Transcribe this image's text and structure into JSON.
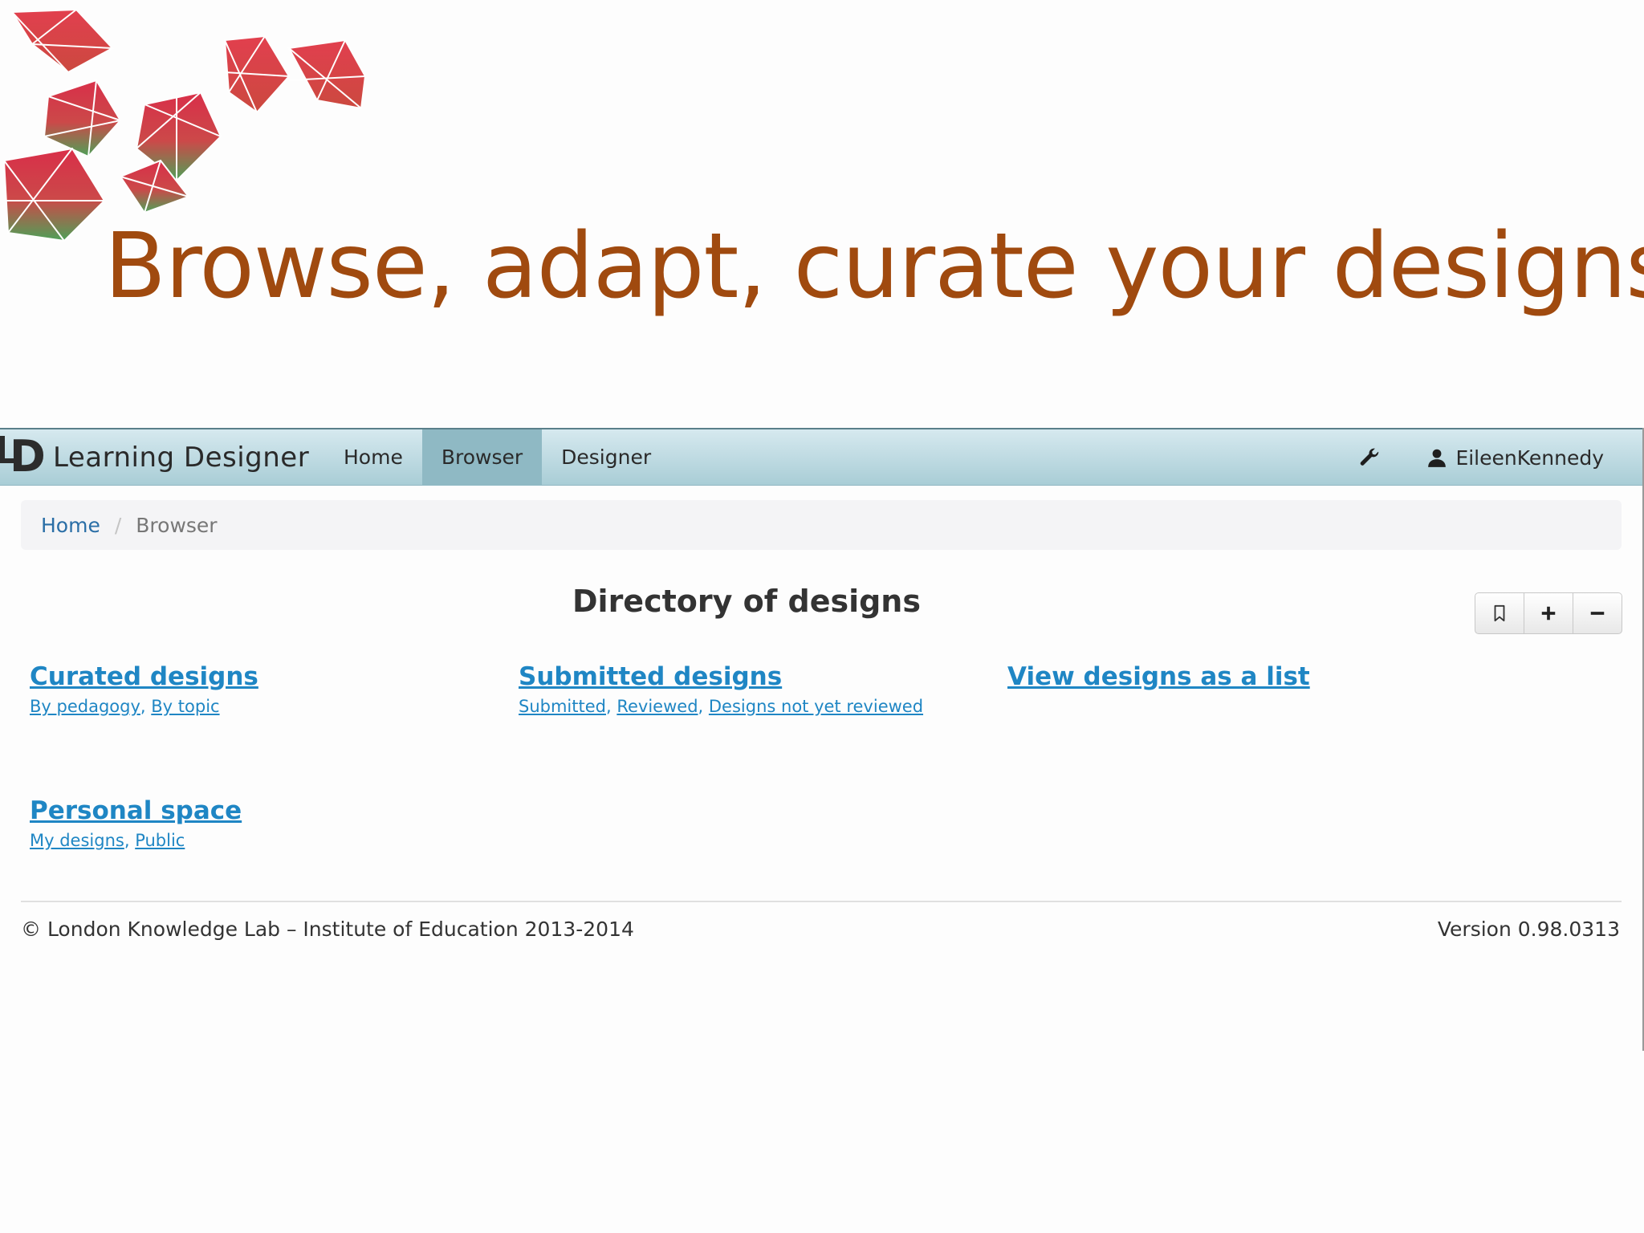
{
  "slide": {
    "title": "Browse, adapt, curate your designs"
  },
  "navbar": {
    "brand_name": "Learning Designer",
    "items": [
      {
        "label": "Home",
        "active": false
      },
      {
        "label": "Browser",
        "active": true
      },
      {
        "label": "Designer",
        "active": false
      }
    ],
    "settings_icon": "wrench-icon",
    "user_icon": "user-icon",
    "username": "EileenKennedy"
  },
  "breadcrumb": {
    "home": "Home",
    "separator": "/",
    "current": "Browser"
  },
  "main": {
    "title": "Directory of designs",
    "toolbar": {
      "icons": [
        "bookmark-icon",
        "plus-icon",
        "minus-icon"
      ]
    },
    "sections": [
      {
        "title": "Curated designs",
        "links": [
          "By pedagogy",
          "By topic"
        ]
      },
      {
        "title": "Submitted designs",
        "links": [
          "Submitted",
          "Reviewed",
          "Designs not yet reviewed"
        ]
      },
      {
        "title": "View designs as a list",
        "links": []
      },
      {
        "title": "Personal space",
        "links": [
          "My designs",
          "Public"
        ]
      }
    ]
  },
  "footer": {
    "copyright": "© London Knowledge Lab – Institute of Education 2013-2014",
    "version": "Version 0.98.0313"
  },
  "colors": {
    "title": "#a04a0f",
    "link": "#1f86c4",
    "navbar_top": "#d6e9ef",
    "navbar_bottom": "#a9cdd6",
    "nav_active": "#8fb9c4"
  }
}
